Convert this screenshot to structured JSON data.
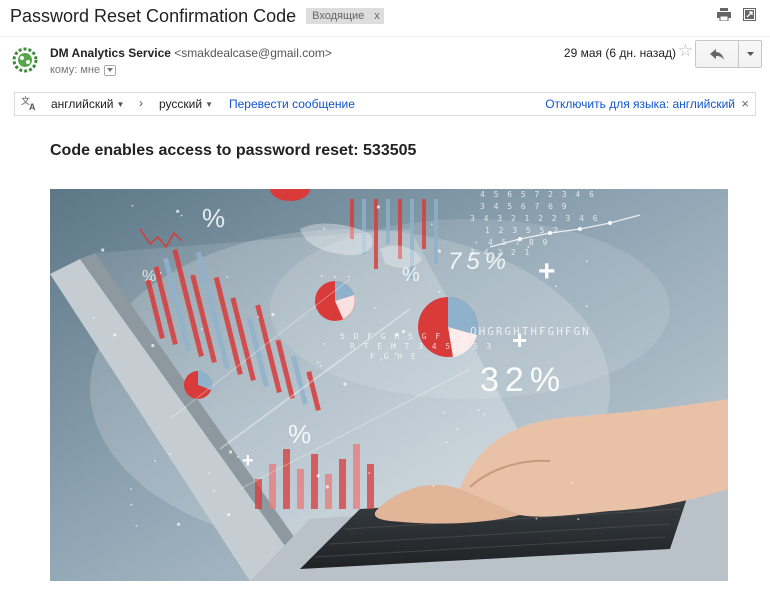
{
  "email": {
    "subject": "Password Reset Confirmation Code",
    "label": "Входящие",
    "label_close": "x",
    "sender_name": "DM Analytics Service",
    "sender_email": "<smakdealcase@gmail.com>",
    "to_line": "кому: мне",
    "date": "29 мая (6 дн. назад)",
    "headline": "Code enables access to password reset: 533505"
  },
  "icons": {
    "print": "print-icon",
    "new_window": "new-window-icon",
    "star": "star-icon",
    "reply": "reply-icon",
    "more": "chevron-down-icon",
    "translate": "translate-icon"
  },
  "translate": {
    "from_lang": "английский",
    "arrow": "›",
    "to_lang": "русский",
    "translate_link": "Перевести сообщение",
    "disable_link": "Отключить для языка: английский",
    "close": "×"
  },
  "image": {
    "overlay_texts": [
      "%",
      "%",
      "%",
      "%",
      "75%",
      "32%",
      "+",
      "+",
      "+"
    ],
    "number_rows": [
      "4 5 6 5 7 2 3 4 6",
      "3 4 5 6 7 6 9",
      "3 4 3 2 1 2 2 3 4 6",
      "1 2 3 5 5 2",
      "4 5 7 8 9",
      "3 4 2 2 1",
      "QHGRGHTHFGHFGN",
      "5 D F G H 5 G F 6 E",
      "R T E H T 3 4 5 5 5 3",
      "F G H E"
    ]
  },
  "colors": {
    "link": "#1155cc",
    "chip_bg": "#dddddd",
    "chart_red": "#d93a3a",
    "chart_blue": "#8fb2cc"
  }
}
